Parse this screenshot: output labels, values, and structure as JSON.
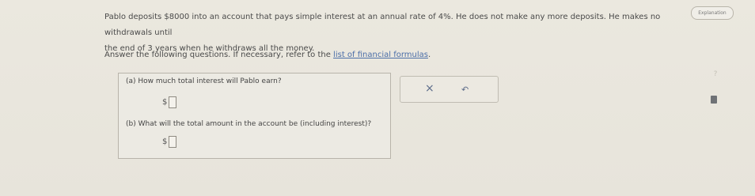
{
  "header": {
    "explain_label": "Explanation"
  },
  "prompt": {
    "line1": "Pablo deposits $8000 into an account that pays simple interest at an annual rate of 4%. He does not make any more deposits. He makes no withdrawals until",
    "line2": "the end of 3 years when he withdraws all the money.",
    "instruction": "Answer the following questions. If necessary, refer to the ",
    "link": "list of financial formulas",
    "instruction_end": "."
  },
  "questions": {
    "a": {
      "text": "(a) How much total interest will Pablo earn?",
      "currency": "$"
    },
    "b": {
      "text": "(b) What will the total amount in the account be (including interest)?",
      "currency": "$"
    }
  },
  "tools": {
    "clear": "×",
    "undo": "↶"
  },
  "side": {
    "help": "?"
  }
}
